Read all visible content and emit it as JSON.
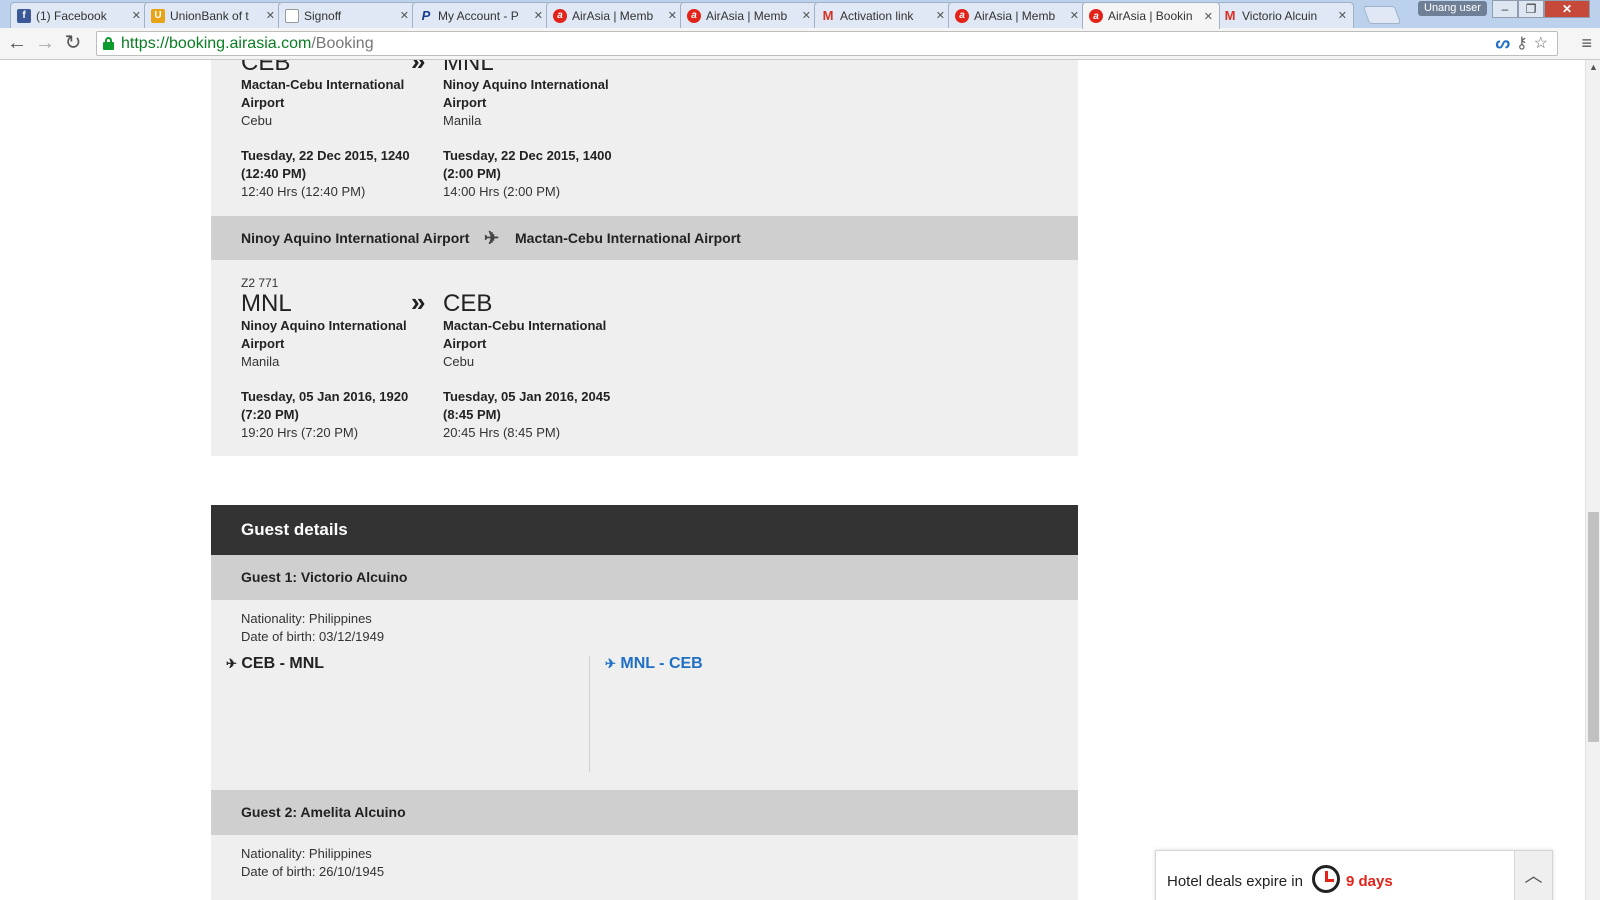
{
  "browser": {
    "tabs": [
      {
        "title": "(1) Facebook",
        "icon": "facebook-icon"
      },
      {
        "title": "UnionBank of t",
        "icon": "unionbank-icon"
      },
      {
        "title": "Signoff",
        "icon": "document-icon"
      },
      {
        "title": "My Account - P",
        "icon": "paypal-icon"
      },
      {
        "title": "AirAsia | Memb",
        "icon": "airasia-icon"
      },
      {
        "title": "AirAsia | Memb",
        "icon": "airasia-icon"
      },
      {
        "title": "Activation link",
        "icon": "gmail-icon"
      },
      {
        "title": "AirAsia | Memb",
        "icon": "airasia-icon"
      },
      {
        "title": "AirAsia | Bookin",
        "icon": "airasia-icon",
        "active": true
      },
      {
        "title": "Victorio Alcuin",
        "icon": "gmail-icon"
      }
    ],
    "user_button": "Unang user",
    "url_host": "https://booking.airasia.com",
    "url_path": "/Booking"
  },
  "flight1": {
    "from_code": "CEB",
    "from_name": "Mactan-Cebu International Airport",
    "from_city": "Cebu",
    "from_date": "Tuesday, 22 Dec 2015, 1240 (12:40 PM)",
    "from_time": "12:40 Hrs (12:40 PM)",
    "to_code": "MNL",
    "to_name": "Ninoy Aquino International Airport",
    "to_city": "Manila",
    "to_date": "Tuesday, 22 Dec 2015, 1400 (2:00 PM)",
    "to_time": "14:00 Hrs (2:00 PM)"
  },
  "route2": {
    "origin": "Ninoy Aquino International Airport",
    "destination": "Mactan-Cebu International Airport"
  },
  "flight2": {
    "flight_no": "Z2 771",
    "from_code": "MNL",
    "from_name": "Ninoy Aquino International Airport",
    "from_city": "Manila",
    "from_date": "Tuesday, 05 Jan 2016, 1920 (7:20 PM)",
    "from_time": "19:20 Hrs (7:20 PM)",
    "to_code": "CEB",
    "to_name": "Mactan-Cebu International Airport",
    "to_city": "Cebu",
    "to_date": "Tuesday, 05 Jan 2016, 2045 (8:45 PM)",
    "to_time": "20:45 Hrs (8:45 PM)"
  },
  "guest_details": {
    "title": "Guest details",
    "guests": [
      {
        "heading": "Guest 1: Victorio Alcuino",
        "nationality": "Nationality: Philippines",
        "dob": "Date of birth: 03/12/1949",
        "segment_out": "CEB - MNL",
        "segment_return": "MNL - CEB"
      },
      {
        "heading": "Guest 2: Amelita Alcuino",
        "nationality": "Nationality: Philippines",
        "dob": "Date of birth: 26/10/1945"
      }
    ]
  },
  "hotel_deals": {
    "text": "Hotel deals expire in",
    "days": "9 days"
  },
  "colors": {
    "link_blue": "#1f6fc5",
    "airasia_red": "#e2231a",
    "header_dark": "#333333"
  }
}
